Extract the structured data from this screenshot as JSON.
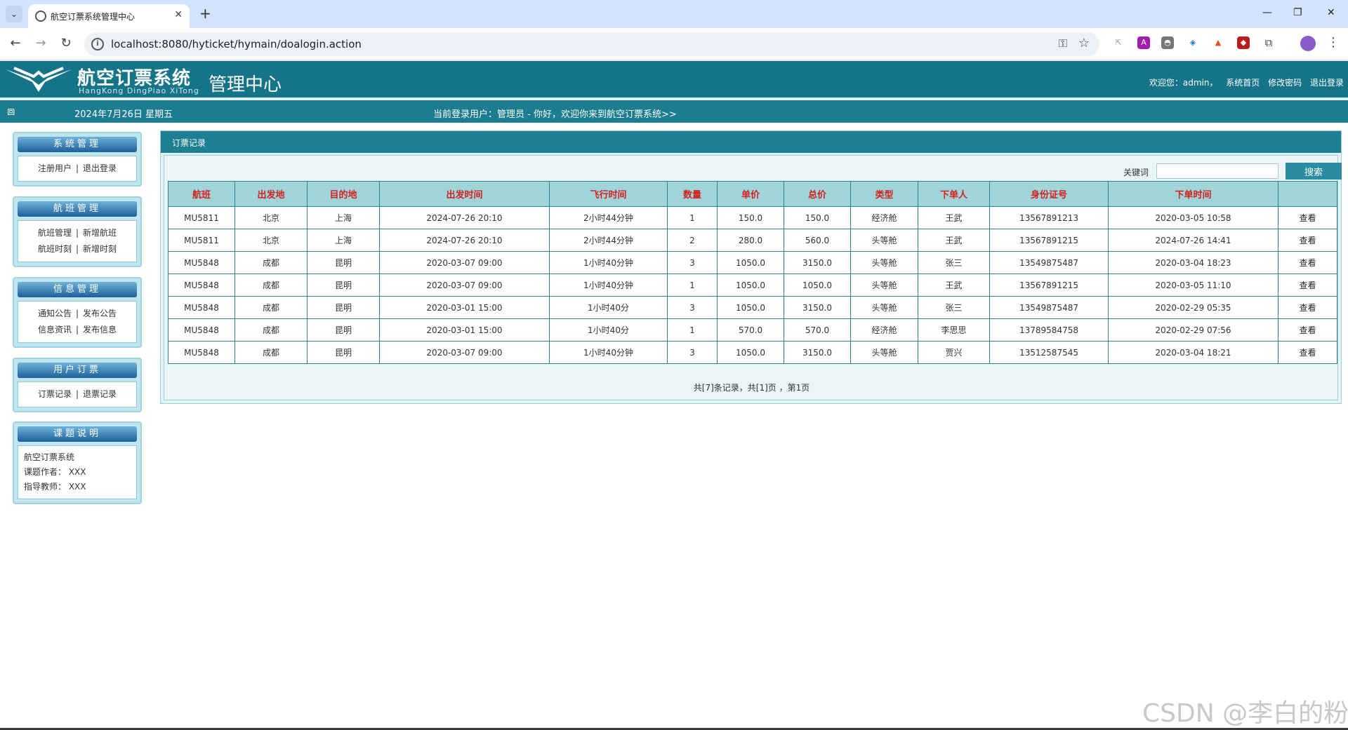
{
  "browser": {
    "tab_title": "航空订票系统管理中心",
    "url": "localhost:8080/hyticket/hymain/doalogin.action"
  },
  "header": {
    "logo_title": "航空订票系统",
    "logo_subtitle": "HangKong DingPiao XiTong",
    "logo_center": "管理中心",
    "welcome": "欢迎您：admin，",
    "link_home": "系统首页",
    "link_password": "修改密码",
    "link_logout": "退出登录"
  },
  "infobar": {
    "date": "2024年7月26日 星期五",
    "welcome": "当前登录用户：管理员 - 你好，欢迎你来到航空订票系统>>"
  },
  "sidebar": {
    "system": {
      "title": "系统管理",
      "items": [
        "注册用户",
        "退出登录"
      ]
    },
    "flight": {
      "title": "航班管理",
      "items": [
        "航班管理",
        "新增航班",
        "航班时刻",
        "新增时刻"
      ]
    },
    "info": {
      "title": "信息管理",
      "items": [
        "通知公告",
        "发布公告",
        "信息资讯",
        "发布信息"
      ]
    },
    "order": {
      "title": "用户订票",
      "items": [
        "订票记录",
        "退票记录"
      ]
    },
    "about": {
      "title": "课题说明",
      "lines": [
        "航空订票系统",
        "课题作者：  XXX",
        "指导教师：  XXX"
      ]
    }
  },
  "main": {
    "panel_title": "订票记录",
    "search_label": "关键词",
    "search_value": "",
    "search_button": "搜索",
    "columns": [
      "航班",
      "出发地",
      "目的地",
      "出发时间",
      "飞行时间",
      "数量",
      "单价",
      "总价",
      "类型",
      "下单人",
      "身份证号",
      "下单时间",
      ""
    ],
    "rows": [
      [
        "MU5811",
        "北京",
        "上海",
        "2024-07-26 20:10",
        "2小时44分钟",
        "1",
        "150.0",
        "150.0",
        "经济舱",
        "王武",
        "13567891213",
        "2020-03-05 10:58",
        "查看"
      ],
      [
        "MU5811",
        "北京",
        "上海",
        "2024-07-26 20:10",
        "2小时44分钟",
        "2",
        "280.0",
        "560.0",
        "头等舱",
        "王武",
        "13567891215",
        "2024-07-26 14:41",
        "查看"
      ],
      [
        "MU5848",
        "成都",
        "昆明",
        "2020-03-07 09:00",
        "1小时40分钟",
        "3",
        "1050.0",
        "3150.0",
        "头等舱",
        "张三",
        "13549875487",
        "2020-03-04 18:23",
        "查看"
      ],
      [
        "MU5848",
        "成都",
        "昆明",
        "2020-03-07 09:00",
        "1小时40分钟",
        "1",
        "1050.0",
        "1050.0",
        "头等舱",
        "王武",
        "13567891215",
        "2020-03-05 11:10",
        "查看"
      ],
      [
        "MU5848",
        "成都",
        "昆明",
        "2020-03-01 15:00",
        "1小时40分",
        "3",
        "1050.0",
        "3150.0",
        "头等舱",
        "张三",
        "13549875487",
        "2020-02-29 05:35",
        "查看"
      ],
      [
        "MU5848",
        "成都",
        "昆明",
        "2020-03-01 15:00",
        "1小时40分",
        "1",
        "570.0",
        "570.0",
        "经济舱",
        "李思思",
        "13789584758",
        "2020-02-29 07:56",
        "查看"
      ],
      [
        "MU5848",
        "成都",
        "昆明",
        "2020-03-07 09:00",
        "1小时40分钟",
        "3",
        "1050.0",
        "3150.0",
        "头等舱",
        "贾兴",
        "13512587545",
        "2020-03-04 18:21",
        "查看"
      ]
    ],
    "pager": "共[7]条记录，共[1]页 ，第1页"
  },
  "watermark": "CSDN @李白的粉",
  "colors": {
    "header_bg": "#157488",
    "table_header_bg": "#9fd5d9",
    "table_header_text": "#d62020",
    "button_bg": "#2a8da1"
  }
}
